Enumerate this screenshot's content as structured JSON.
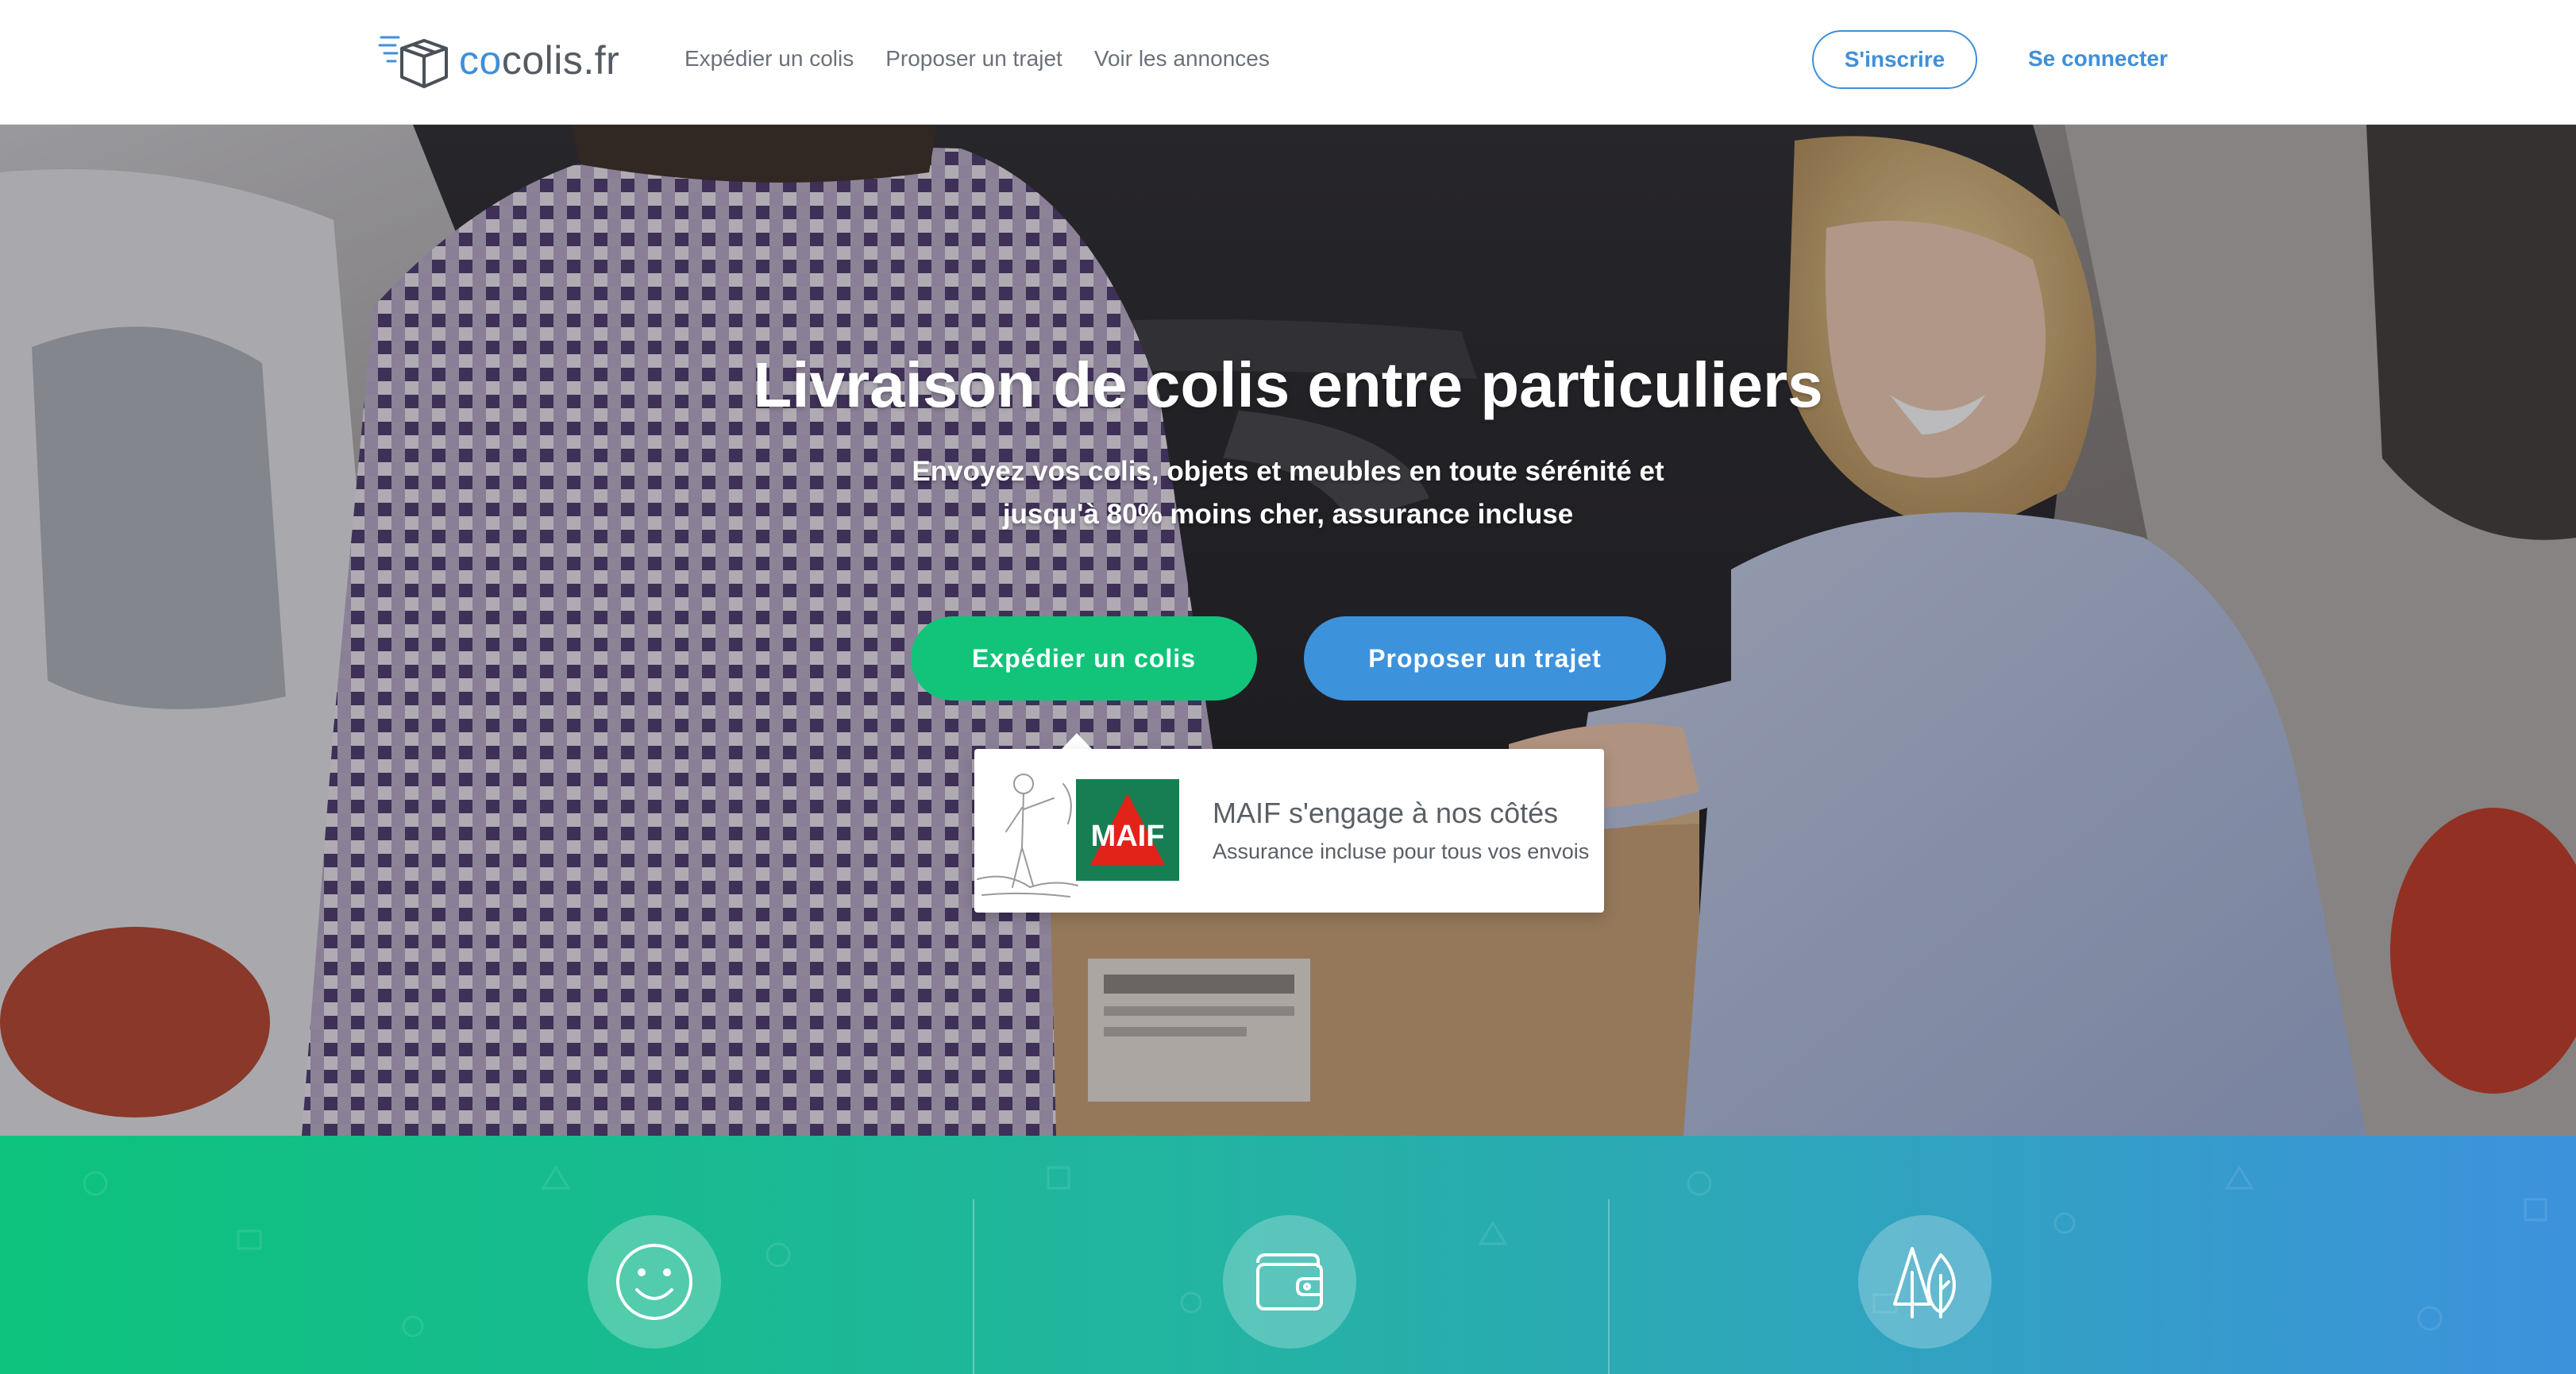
{
  "header": {
    "logo": {
      "prefix": "co",
      "suffix": "colis.fr",
      "icon": "box-logo-icon"
    },
    "nav": [
      {
        "label": "Expédier un colis"
      },
      {
        "label": "Proposer un trajet"
      },
      {
        "label": "Voir les annonces"
      }
    ],
    "signup_label": "S'inscrire",
    "login_label": "Se connecter"
  },
  "hero": {
    "title": "Livraison de colis entre particuliers",
    "subtitle_line1": "Envoyez vos colis, objets et meubles en toute sérénité et",
    "subtitle_line2": "jusqu'à 80% moins cher, assurance incluse",
    "cta_send": "Expédier un colis",
    "cta_trip": "Proposer un trajet",
    "maif": {
      "logo_text": "MAIF",
      "title": "MAIF s'engage à nos côtés",
      "subtitle": "Assurance incluse pour tous vos envois"
    }
  },
  "features": {
    "icons": [
      "smiley-icon",
      "wallet-icon",
      "trees-icon"
    ]
  },
  "colors": {
    "accent_blue": "#3f8fd8",
    "accent_green": "#11c47a",
    "maif_green": "#177e53",
    "maif_red": "#e2231a"
  }
}
